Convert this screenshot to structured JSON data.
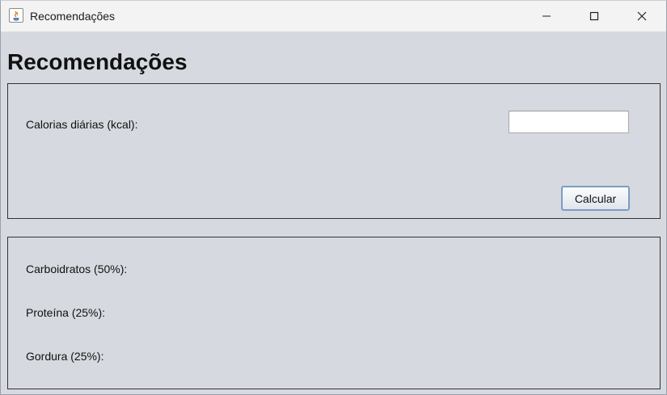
{
  "window": {
    "title": "Recomendações",
    "controls": {
      "minimize": "minimize-icon",
      "maximize": "maximize-icon",
      "close": "close-icon"
    }
  },
  "page": {
    "heading": "Recomendações"
  },
  "input_panel": {
    "calories_label": "Calorias diárias (kcal):",
    "calories_value": "",
    "calculate_button": "Calcular"
  },
  "results_panel": {
    "carbs_label": "Carboidratos (50%):",
    "protein_label": "Proteína (25%):",
    "fat_label": "Gordura (25%):"
  }
}
